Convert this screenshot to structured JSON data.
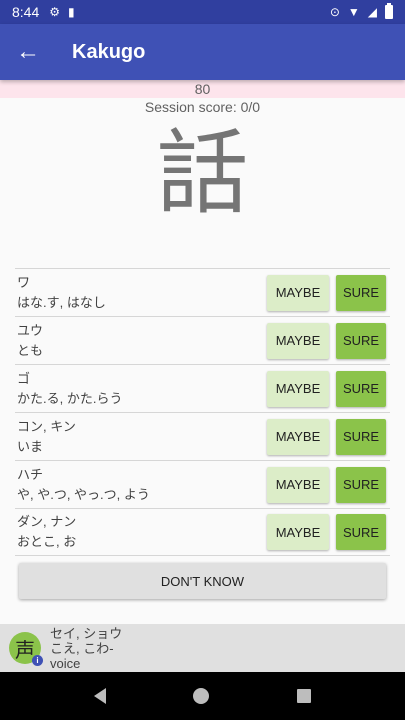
{
  "status_bar": {
    "time": "8:44",
    "icons": [
      "gear-icon",
      "sd-card-icon",
      "location-icon",
      "wifi-icon",
      "signal-icon",
      "battery-icon"
    ]
  },
  "app_bar": {
    "title": "Kakugo",
    "back_icon": "arrow-back-icon"
  },
  "progress": {
    "value": "80"
  },
  "session_score": "Session score: 0/0",
  "kanji": "話",
  "answers": [
    {
      "line1": "ワ",
      "line2": "はな.す, はなし"
    },
    {
      "line1": "ユウ",
      "line2": "とも"
    },
    {
      "line1": "ゴ",
      "line2": "かた.る, かた.らう"
    },
    {
      "line1": "コン, キン",
      "line2": "いま"
    },
    {
      "line1": "ハチ",
      "line2": "や, や.つ, やっ.つ, よう"
    },
    {
      "line1": "ダン, ナン",
      "line2": "おとこ, お"
    }
  ],
  "buttons": {
    "maybe": "MAYBE",
    "sure": "SURE",
    "dont_know": "DON'T KNOW"
  },
  "info": {
    "kanji": "声",
    "info_badge": "i",
    "readings": "セイ, ショウ",
    "kun": "こえ, こわ-",
    "meaning": "voice"
  },
  "colors": {
    "status_bar": "#303f9f",
    "app_bar": "#3f51b5",
    "maybe": "#dcedc8",
    "sure": "#8bc34a",
    "progress_strip": "#fde4ec"
  }
}
